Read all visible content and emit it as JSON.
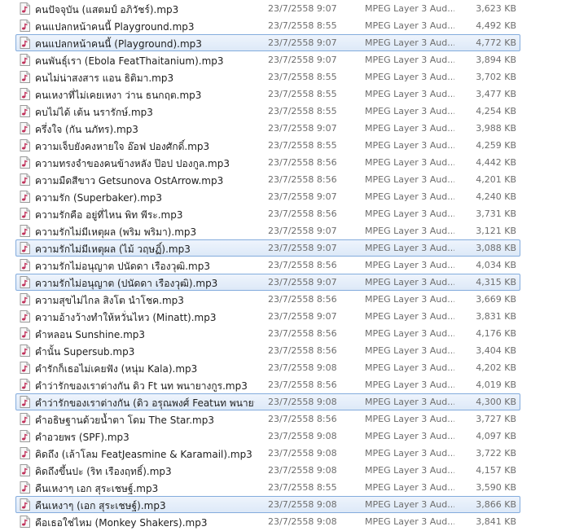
{
  "files": [
    {
      "name": "คนปัจจุบัน (แสตมป์ อภิวัชร์).mp3",
      "date": "23/7/2558 9:07",
      "type": "MPEG Layer 3 Aud...",
      "size": "3,623 KB",
      "selected": false
    },
    {
      "name": "คนแปลกหน้าคนนี้ Playground.mp3",
      "date": "23/7/2558 8:55",
      "type": "MPEG Layer 3 Aud...",
      "size": "4,492 KB",
      "selected": false
    },
    {
      "name": "คนแปลกหน้าคนนี้ (Playground).mp3",
      "date": "23/7/2558 9:07",
      "type": "MPEG Layer 3 Aud...",
      "size": "4,772 KB",
      "selected": true
    },
    {
      "name": "คนพันธุ์เรา (Ebola FeatThaitanium).mp3",
      "date": "23/7/2558 9:07",
      "type": "MPEG Layer 3 Aud...",
      "size": "3,894 KB",
      "selected": false
    },
    {
      "name": "คนไม่น่าสงสาร แอน ธิติมา.mp3",
      "date": "23/7/2558 8:55",
      "type": "MPEG Layer 3 Aud...",
      "size": "3,702 KB",
      "selected": false
    },
    {
      "name": "คนเหงาที่ไม่เคยเหงา ว่าน ธนกฤต.mp3",
      "date": "23/7/2558 8:55",
      "type": "MPEG Layer 3 Aud...",
      "size": "3,477 KB",
      "selected": false
    },
    {
      "name": "คบไม่ได้ เต้น นรารักษ์.mp3",
      "date": "23/7/2558 8:55",
      "type": "MPEG Layer 3 Aud...",
      "size": "4,254 KB",
      "selected": false
    },
    {
      "name": "ครึ่งใจ (กัน นภัทร).mp3",
      "date": "23/7/2558 9:07",
      "type": "MPEG Layer 3 Aud...",
      "size": "3,988 KB",
      "selected": false
    },
    {
      "name": "ความเจ็บยังคงหายใจ อ๊อฟ ปองศักดิ์.mp3",
      "date": "23/7/2558 8:55",
      "type": "MPEG Layer 3 Aud...",
      "size": "4,259 KB",
      "selected": false
    },
    {
      "name": "ความทรงจำของคนข้างหลัง ป๊อป ปองกูล.mp3",
      "date": "23/7/2558 8:56",
      "type": "MPEG Layer 3 Aud...",
      "size": "4,442 KB",
      "selected": false
    },
    {
      "name": "ความมืดสีขาว Getsunova OstArrow.mp3",
      "date": "23/7/2558 8:56",
      "type": "MPEG Layer 3 Aud...",
      "size": "4,201 KB",
      "selected": false
    },
    {
      "name": "ความรัก (Superbaker).mp3",
      "date": "23/7/2558 9:07",
      "type": "MPEG Layer 3 Aud...",
      "size": "4,240 KB",
      "selected": false
    },
    {
      "name": "ความรักคือ อยู่ที่ไหน พิท พีระ.mp3",
      "date": "23/7/2558 8:56",
      "type": "MPEG Layer 3 Aud...",
      "size": "3,731 KB",
      "selected": false
    },
    {
      "name": "ความรักไม่มีเหตุผล (พริม พริมา).mp3",
      "date": "23/7/2558 9:07",
      "type": "MPEG Layer 3 Aud...",
      "size": "3,121 KB",
      "selected": false
    },
    {
      "name": "ความรักไม่มีเหตุผล (ไม้ วฤษฏิ์).mp3",
      "date": "23/7/2558 9:07",
      "type": "MPEG Layer 3 Aud...",
      "size": "3,088 KB",
      "selected": true
    },
    {
      "name": "ความรักไม่อนุญาต ปนัดดา เรืองวุฒิ.mp3",
      "date": "23/7/2558 8:56",
      "type": "MPEG Layer 3 Aud...",
      "size": "4,034 KB",
      "selected": false
    },
    {
      "name": "ความรักไม่อนุญาต (ปนัดดา เรืองวุฒิ).mp3",
      "date": "23/7/2558 9:07",
      "type": "MPEG Layer 3 Aud...",
      "size": "4,315 KB",
      "selected": true
    },
    {
      "name": "ความสุขไม่ไกล สิงโต นำโชค.mp3",
      "date": "23/7/2558 8:56",
      "type": "MPEG Layer 3 Aud...",
      "size": "3,669 KB",
      "selected": false
    },
    {
      "name": "ความอ้างว้างทำให้หวั่นไหว (Minatt).mp3",
      "date": "23/7/2558 9:07",
      "type": "MPEG Layer 3 Aud...",
      "size": "3,831 KB",
      "selected": false
    },
    {
      "name": "คำหลอน Sunshine.mp3",
      "date": "23/7/2558 8:56",
      "type": "MPEG Layer 3 Aud...",
      "size": "4,176 KB",
      "selected": false
    },
    {
      "name": "คำนั้น Supersub.mp3",
      "date": "23/7/2558 8:56",
      "type": "MPEG Layer 3 Aud...",
      "size": "3,404 KB",
      "selected": false
    },
    {
      "name": "คำรักก็เธอไม่เคยฟัง (หนุ่ม Kala).mp3",
      "date": "23/7/2558 9:08",
      "type": "MPEG Layer 3 Aud...",
      "size": "4,202 KB",
      "selected": false
    },
    {
      "name": "คำว่ารักของเราต่างกัน ดิว Ft นท พนายางกูร.mp3",
      "date": "23/7/2558 8:56",
      "type": "MPEG Layer 3 Aud...",
      "size": "4,019 KB",
      "selected": false
    },
    {
      "name": "คำว่ารักของเราต่างกัน (ดิว อรุณพงศ์ Featนท พนายางกูร...",
      "date": "23/7/2558 9:08",
      "type": "MPEG Layer 3 Aud...",
      "size": "4,300 KB",
      "selected": true
    },
    {
      "name": "คำอธิษฐานด้วยน้ำตา โดม The Star.mp3",
      "date": "23/7/2558 8:56",
      "type": "MPEG Layer 3 Aud...",
      "size": "3,727 KB",
      "selected": false
    },
    {
      "name": "คำอวยพร (SPF).mp3",
      "date": "23/7/2558 9:08",
      "type": "MPEG Layer 3 Aud...",
      "size": "4,097 KB",
      "selected": false
    },
    {
      "name": "คิดถึง (เล้าโลม FeatJeasmine & Karamail).mp3",
      "date": "23/7/2558 9:08",
      "type": "MPEG Layer 3 Aud...",
      "size": "3,722 KB",
      "selected": false
    },
    {
      "name": "คิดถึงขึ้นปะ (ริท เรืองฤทธิ์).mp3",
      "date": "23/7/2558 9:08",
      "type": "MPEG Layer 3 Aud...",
      "size": "4,157 KB",
      "selected": false
    },
    {
      "name": "คืนเหงาๆ เอก สุระเชษฐ์.mp3",
      "date": "23/7/2558 8:55",
      "type": "MPEG Layer 3 Aud...",
      "size": "3,590 KB",
      "selected": false
    },
    {
      "name": "คืนเหงาๆ (เอก สุระเชษฐ์).mp3",
      "date": "23/7/2558 9:08",
      "type": "MPEG Layer 3 Aud...",
      "size": "3,866 KB",
      "selected": true
    },
    {
      "name": "คือเธอใช่ไหม (Monkey Shakers).mp3",
      "date": "23/7/2558 9:08",
      "type": "MPEG Layer 3 Aud...",
      "size": "3,841 KB",
      "selected": false
    }
  ]
}
